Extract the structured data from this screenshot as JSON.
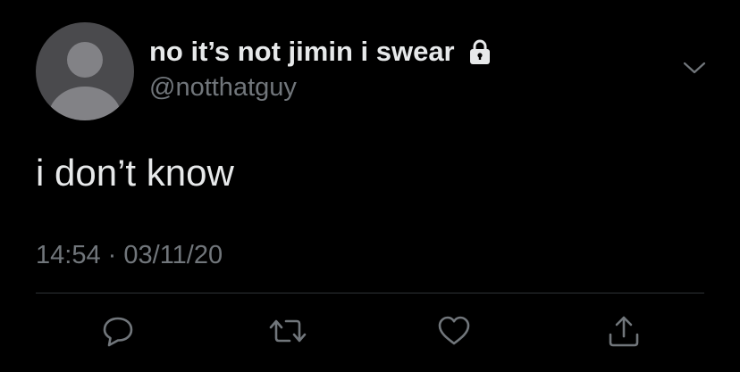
{
  "tweet": {
    "author": {
      "display_name": "no it’s not jimin i swear",
      "handle": "@notthatguy",
      "protected": true,
      "avatar_icon": "default-profile-avatar"
    },
    "text": "i don’t know",
    "time": "14:54",
    "separator": "·",
    "date": "03/11/20"
  },
  "actions": [
    {
      "name": "reply",
      "icon": "reply-icon"
    },
    {
      "name": "retweet",
      "icon": "retweet-icon"
    },
    {
      "name": "like",
      "icon": "heart-icon"
    },
    {
      "name": "share",
      "icon": "share-icon"
    }
  ],
  "colors": {
    "background": "#000000",
    "primary_text": "#e7e9ea",
    "secondary_text": "#71767b",
    "divider": "#2f3336"
  }
}
